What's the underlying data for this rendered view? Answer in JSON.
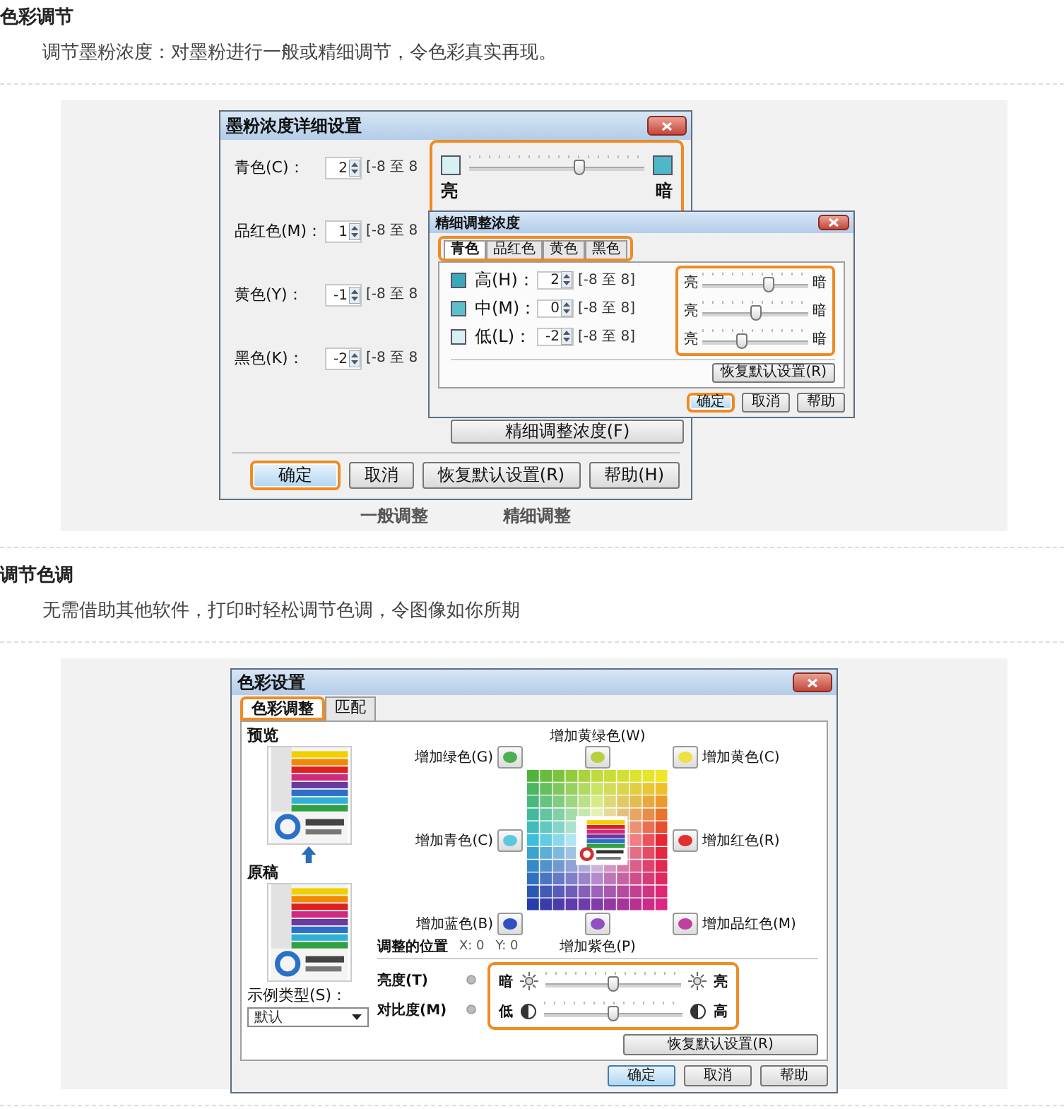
{
  "toner_section": {
    "heading": "色彩调节",
    "description": "调节墨粉浓度：对墨粉进行一般或精细调节，令色彩真实再现。",
    "main_dialog": {
      "title": "墨粉浓度详细设置",
      "rows": [
        {
          "label": "青色(C)：",
          "value": "2",
          "range": "[-8 至 8"
        },
        {
          "label": "品红色(M)：",
          "value": "1",
          "range": "[-8 至 8"
        },
        {
          "label": "黄色(Y)：",
          "value": "-1",
          "range": "[-8 至 8"
        },
        {
          "label": "黑色(K)：",
          "value": "-2",
          "range": "[-8 至 8"
        }
      ],
      "slider": {
        "level": 0.625,
        "left_label": "亮",
        "right_label": "暗"
      },
      "fine_button": "精细调整浓度(F)",
      "buttons": [
        {
          "label": "确定",
          "default": true,
          "highlighted": true
        },
        {
          "label": "取消",
          "default": false,
          "highlighted": false
        },
        {
          "label": "恢复默认设置(R)",
          "default": false,
          "highlighted": false
        },
        {
          "label": "帮助(H)",
          "default": false,
          "highlighted": false
        }
      ]
    },
    "fine_dialog": {
      "title": "精细调整浓度",
      "tabs": [
        {
          "label": "青色",
          "selected": true
        },
        {
          "label": "品红色",
          "selected": false
        },
        {
          "label": "黄色",
          "selected": false
        },
        {
          "label": "黑色",
          "selected": false
        }
      ],
      "rows": [
        {
          "label": "高(H)：",
          "color": "#3aa8b8",
          "value": "2",
          "range": "[-8 至 8]",
          "left_label": "亮",
          "right_label": "暗",
          "level": 0.625
        },
        {
          "label": "中(M)：",
          "color": "#5cc0cc",
          "value": "0",
          "range": "[-8 至 8]",
          "left_label": "亮",
          "right_label": "暗",
          "level": 0.5
        },
        {
          "label": "低(L)：",
          "color": "#d6f0f3",
          "value": "-2",
          "range": "[-8 至 8]",
          "left_label": "亮",
          "right_label": "暗",
          "level": 0.375
        }
      ],
      "reset_button": "恢复默认设置(R)",
      "buttons": [
        {
          "label": "确定",
          "default": true,
          "highlighted": true
        },
        {
          "label": "取消",
          "default": false,
          "highlighted": false
        },
        {
          "label": "帮助",
          "default": false,
          "highlighted": false
        }
      ]
    },
    "captions": [
      "一般调整",
      "精细调整"
    ]
  },
  "tone_section": {
    "heading": "调节色调",
    "description": "无需借助其他软件，打印时轻松调节色调，令图像如你所期",
    "dialog": {
      "title": "色彩设置",
      "tabs": [
        {
          "label": "色彩调整",
          "selected": true,
          "highlighted": true
        },
        {
          "label": "匹配",
          "selected": false,
          "highlighted": false
        }
      ],
      "preview_label": "预览",
      "original_label": "原稿",
      "sample_type_label": "示例类型(S)：",
      "sample_type_value": "默认",
      "color_buttons": [
        {
          "label": "增加黄绿色(W)",
          "color": "#b8d040"
        },
        {
          "label": "增加绿色(G)",
          "color": "#4caf50"
        },
        {
          "label": "增加黄色(C)",
          "color": "#f0e040"
        },
        {
          "label": "增加青色(C)",
          "color": "#5cc8e0"
        },
        {
          "label": "增加红色(R)",
          "color": "#e03030"
        },
        {
          "label": "增加蓝色(B)",
          "color": "#3050c0"
        },
        {
          "label": "增加紫色(P)",
          "color": "#9050c0"
        },
        {
          "label": "增加品红色(M)",
          "color": "#c040a0"
        }
      ],
      "position": {
        "label": "调整的位置",
        "x": "X: 0",
        "y": "Y: 0"
      },
      "sliders": [
        {
          "kind": "brightness",
          "label": "亮度(T)",
          "left_label": "暗",
          "right_label": "亮",
          "level": 0.5
        },
        {
          "kind": "contrast",
          "label": "对比度(M)",
          "left_label": "低",
          "right_label": "高",
          "level": 0.5
        }
      ],
      "reset_button": "恢复默认设置(R)",
      "buttons": [
        {
          "label": "确定",
          "default": true,
          "highlighted": false
        },
        {
          "label": "取消",
          "default": false,
          "highlighted": false
        },
        {
          "label": "帮助",
          "default": false,
          "highlighted": false
        }
      ]
    }
  }
}
